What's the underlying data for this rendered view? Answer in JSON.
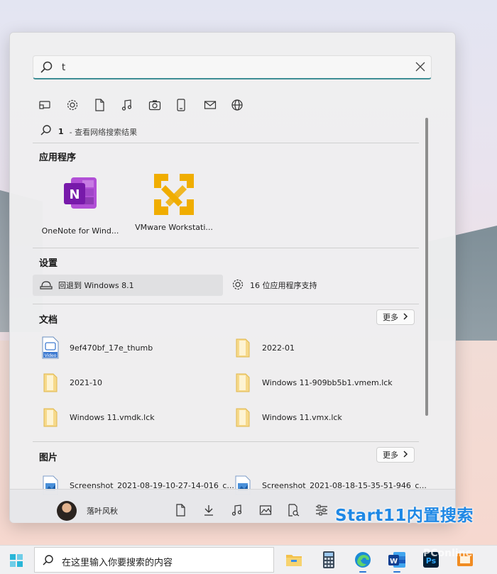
{
  "search": {
    "value": "t"
  },
  "filters": [
    "apps-filter-icon",
    "settings-filter-icon",
    "documents-filter-icon",
    "music-filter-icon",
    "photos-filter-icon",
    "devices-filter-icon",
    "mail-filter-icon",
    "web-filter-icon"
  ],
  "web_search": {
    "query": "1",
    "suffix": "- 查看网络搜索结果"
  },
  "apps": {
    "header": "应用程序",
    "items": [
      {
        "label": "OneNote for Wind...",
        "icon": "onenote-icon"
      },
      {
        "label": "VMware Workstati...",
        "icon": "vmware-icon"
      }
    ]
  },
  "settings": {
    "header": "设置",
    "items": [
      {
        "label": "回退到 Windows 8.1",
        "icon": "recovery-icon"
      },
      {
        "label": "16 位应用程序支持",
        "icon": "gear-icon"
      }
    ]
  },
  "documents": {
    "header": "文档",
    "more_label": "更多",
    "items": [
      {
        "label": "9ef470bf_17e_thumb",
        "icon": "video-file-icon"
      },
      {
        "label": "2022-01",
        "icon": "folder-icon"
      },
      {
        "label": "2021-10",
        "icon": "folder-icon"
      },
      {
        "label": "Windows 11-909bb5b1.vmem.lck",
        "icon": "folder-icon"
      },
      {
        "label": "Windows 11.vmdk.lck",
        "icon": "folder-icon"
      },
      {
        "label": "Windows 11.vmx.lck",
        "icon": "folder-icon"
      }
    ]
  },
  "pictures": {
    "header": "图片",
    "more_label": "更多",
    "items": [
      {
        "label": "Screenshot_2021-08-19-10-27-14-016_c...",
        "icon": "image-file-icon"
      },
      {
        "label": "Screenshot_2021-08-18-15-35-51-946_c...",
        "icon": "image-file-icon"
      }
    ]
  },
  "footer": {
    "username": "落叶风秋",
    "buttons": [
      "documents-icon",
      "downloads-icon",
      "music-icon",
      "pictures-icon",
      "explorer-icon",
      "settings-sliders-icon"
    ]
  },
  "caption": "Start11内置搜索",
  "taskbar": {
    "search_text": "在这里输入你要搜索的内容",
    "apps": [
      "file-explorer-icon",
      "calculator-icon",
      "edge-icon",
      "word-icon",
      "photoshop-icon",
      "app-icon"
    ]
  },
  "watermark": "PConline"
}
